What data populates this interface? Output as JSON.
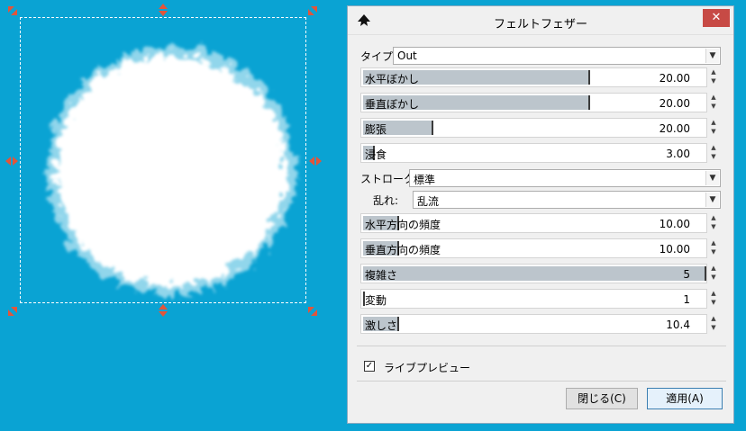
{
  "dialog": {
    "title": "フェルトフェザー",
    "close_glyph": "✕",
    "type_label": "タイプ:",
    "type_value": "Out",
    "stroke_label": "ストローク:",
    "stroke_value": "標準",
    "turbulence_label": "乱れ:",
    "turbulence_value": "乱流",
    "sliders": [
      {
        "label": "水平ぼかし",
        "value": "20.00",
        "fill": 0.66
      },
      {
        "label": "垂直ぼかし",
        "value": "20.00",
        "fill": 0.66
      },
      {
        "label": "膨張",
        "value": "20.00",
        "fill": 0.2
      },
      {
        "label": "浸食",
        "value": "3.00",
        "fill": 0.03
      },
      {
        "label": "水平方向の頻度",
        "value": "10.00",
        "fill": 0.1
      },
      {
        "label": "垂直方向の頻度",
        "value": "10.00",
        "fill": 0.1
      },
      {
        "label": "複雑さ",
        "value": "5",
        "fill": 1.0
      },
      {
        "label": "変動",
        "value": "1",
        "fill": 0.0
      },
      {
        "label": "激しさ",
        "value": "10.4",
        "fill": 0.1
      }
    ],
    "live_preview_label": "ライブプレビュー",
    "live_preview_checked": true,
    "close_button": "閉じる(C)",
    "apply_button": "適用(A)"
  },
  "colors": {
    "canvas_bg": "#0aa3d3",
    "handle": "#e2553a",
    "slider_fill": "#bcc5cc",
    "close_btn": "#c74a45"
  },
  "icons": [
    "inkscape-icon",
    "close-icon",
    "dropdown-arrow-icon",
    "spin-up-icon",
    "spin-down-icon",
    "checkmark-icon",
    "resize-handle-icon"
  ]
}
